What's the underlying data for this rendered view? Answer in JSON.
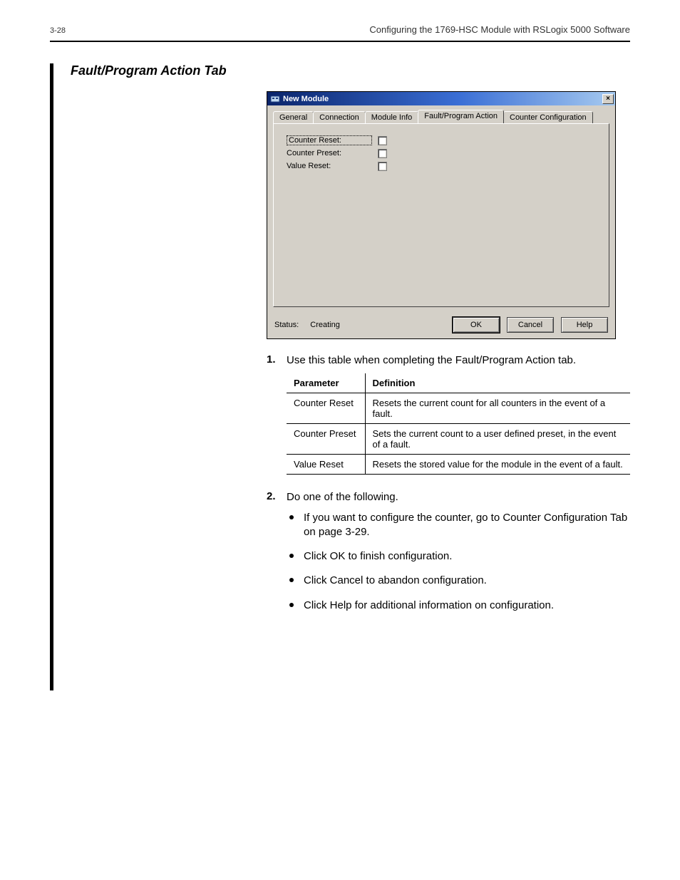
{
  "header": {
    "page_num": "3-28",
    "doc_title": "Configuring the 1769-HSC Module with RSLogix 5000 Software"
  },
  "section_title": "Fault/Program Action Tab",
  "dialog": {
    "title": "New Module",
    "tabs": [
      "General",
      "Connection",
      "Module Info",
      "Fault/Program Action",
      "Counter Configuration"
    ],
    "active_tab_index": 3,
    "fields": [
      {
        "label": "Counter Reset:",
        "dotted": true
      },
      {
        "label": "Counter Preset:",
        "dotted": false
      },
      {
        "label": "Value Reset:",
        "dotted": false
      }
    ],
    "status_label": "Status:",
    "status_value": "Creating",
    "buttons": {
      "ok": "OK",
      "cancel": "Cancel",
      "help": "Help"
    },
    "close_glyph": "×"
  },
  "step1": {
    "num": "1.",
    "text": "Use this table when completing the Fault/Program Action tab.",
    "table": {
      "head": [
        "Parameter",
        "Definition"
      ],
      "rows": [
        [
          "Counter Reset",
          "Resets the current count for all counters in the event of a fault."
        ],
        [
          "Counter Preset",
          "Sets the current count to a user defined preset, in the event of a fault."
        ],
        [
          "Value Reset",
          "Resets the stored value for the module in the event of a fault."
        ]
      ]
    }
  },
  "step2": {
    "num": "2.",
    "text": "Do one of the following.",
    "bullets": [
      "If you want to configure the counter, go to Counter Configuration Tab on page 3-29.",
      "Click OK to finish configuration.",
      "Click Cancel to abandon configuration.",
      "Click Help for additional information on configuration."
    ]
  }
}
